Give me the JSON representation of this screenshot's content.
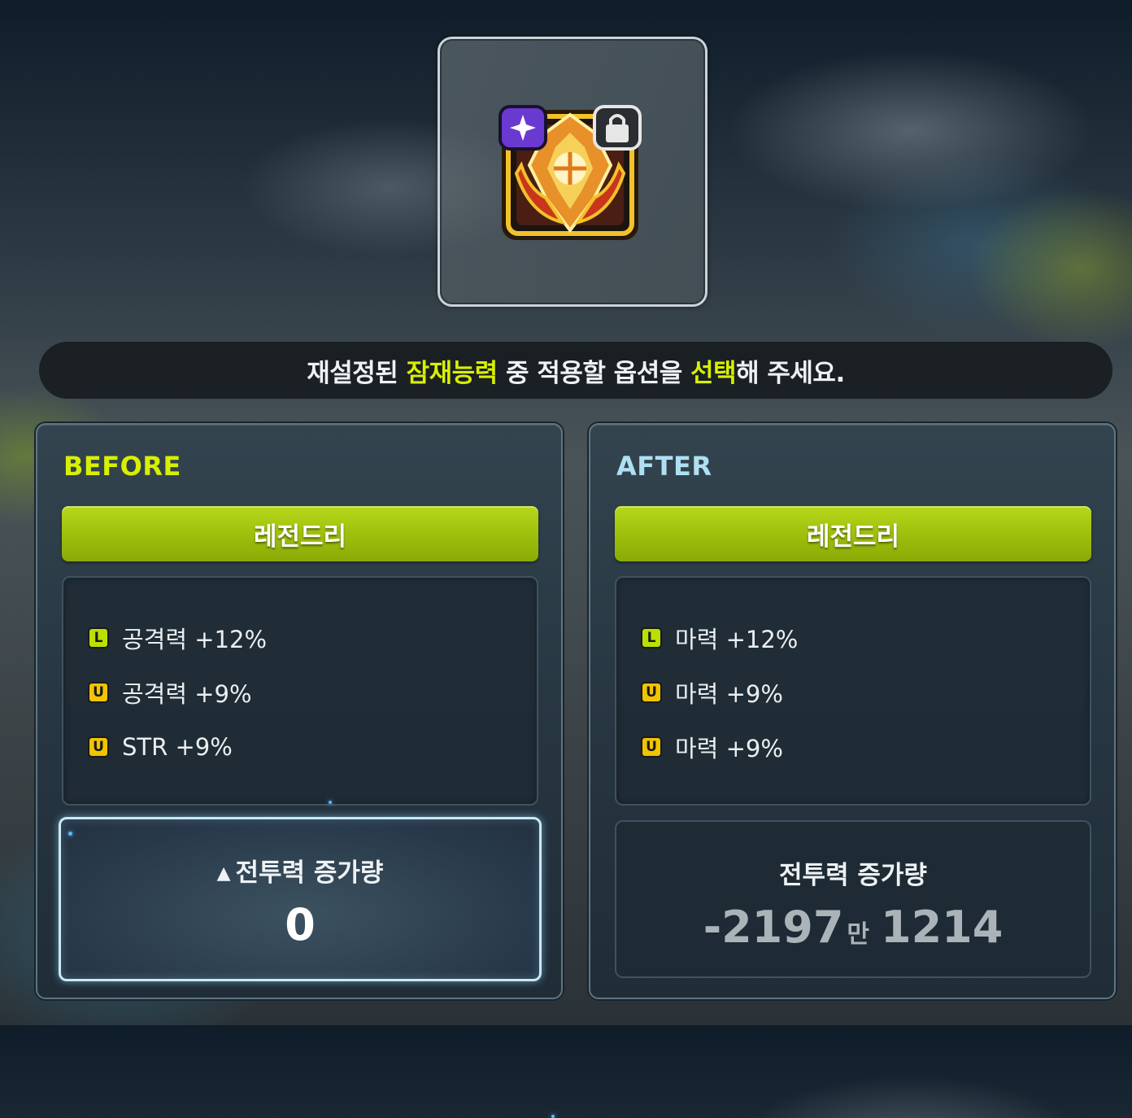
{
  "item": {
    "icon": "emblem-icon"
  },
  "banner": {
    "part1": "재설정된 ",
    "highlight1": "잠재능력",
    "part2": " 중 적용할 옵션을 ",
    "highlight2": "선택",
    "part3": "해 주세요."
  },
  "before": {
    "title": "BEFORE",
    "grade": "레전드리",
    "options": [
      {
        "badge": "L",
        "text": "공격력 +12%"
      },
      {
        "badge": "U",
        "text": "공격력 +9%"
      },
      {
        "badge": "U",
        "text": "STR +9%"
      }
    ],
    "power_label": "전투력 증가량",
    "power_value": "0"
  },
  "after": {
    "title": "AFTER",
    "grade": "레전드리",
    "options": [
      {
        "badge": "L",
        "text": "마력 +12%"
      },
      {
        "badge": "U",
        "text": "마력 +9%"
      },
      {
        "badge": "U",
        "text": "마력 +9%"
      }
    ],
    "power_label": "전투력 증가량",
    "power_value_main": "-2197",
    "power_value_unit": "만",
    "power_value_rest": "1214"
  },
  "colors": {
    "highlight": "#d8f000",
    "legendary": "#9cbe0c",
    "after_title": "#aee0f2"
  }
}
